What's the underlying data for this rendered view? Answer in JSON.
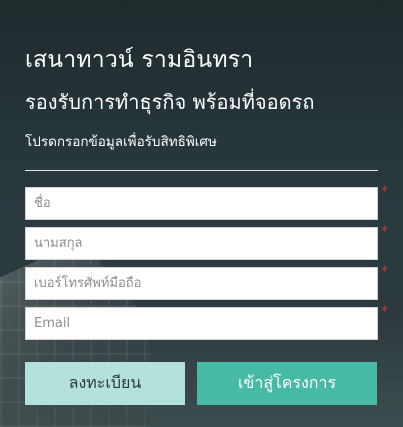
{
  "header": {
    "title": "เสนาทาวน์ รามอินทรา",
    "subtitle": "รองรับการทำธุรกิจ พร้อมที่จอดรถ",
    "description": "โปรดกรอกข้อมูลเพื่อรับสิทธิพิเศษ"
  },
  "form": {
    "first_name": {
      "placeholder": "ชื่อ",
      "value": ""
    },
    "last_name": {
      "placeholder": "นามสกุล",
      "value": ""
    },
    "phone": {
      "placeholder": "เบอร์โทรศัพท์มือถือ",
      "value": ""
    },
    "email": {
      "placeholder": "Email",
      "value": ""
    },
    "required_mark": "*"
  },
  "buttons": {
    "register_label": "ลงทะเบียน",
    "project_label": "เข้าสู่โครงการ"
  },
  "colors": {
    "background": "#2a3a3f",
    "register_button": "#b3e2dc",
    "project_button": "#47baa6",
    "required_mark": "#c0392b"
  }
}
